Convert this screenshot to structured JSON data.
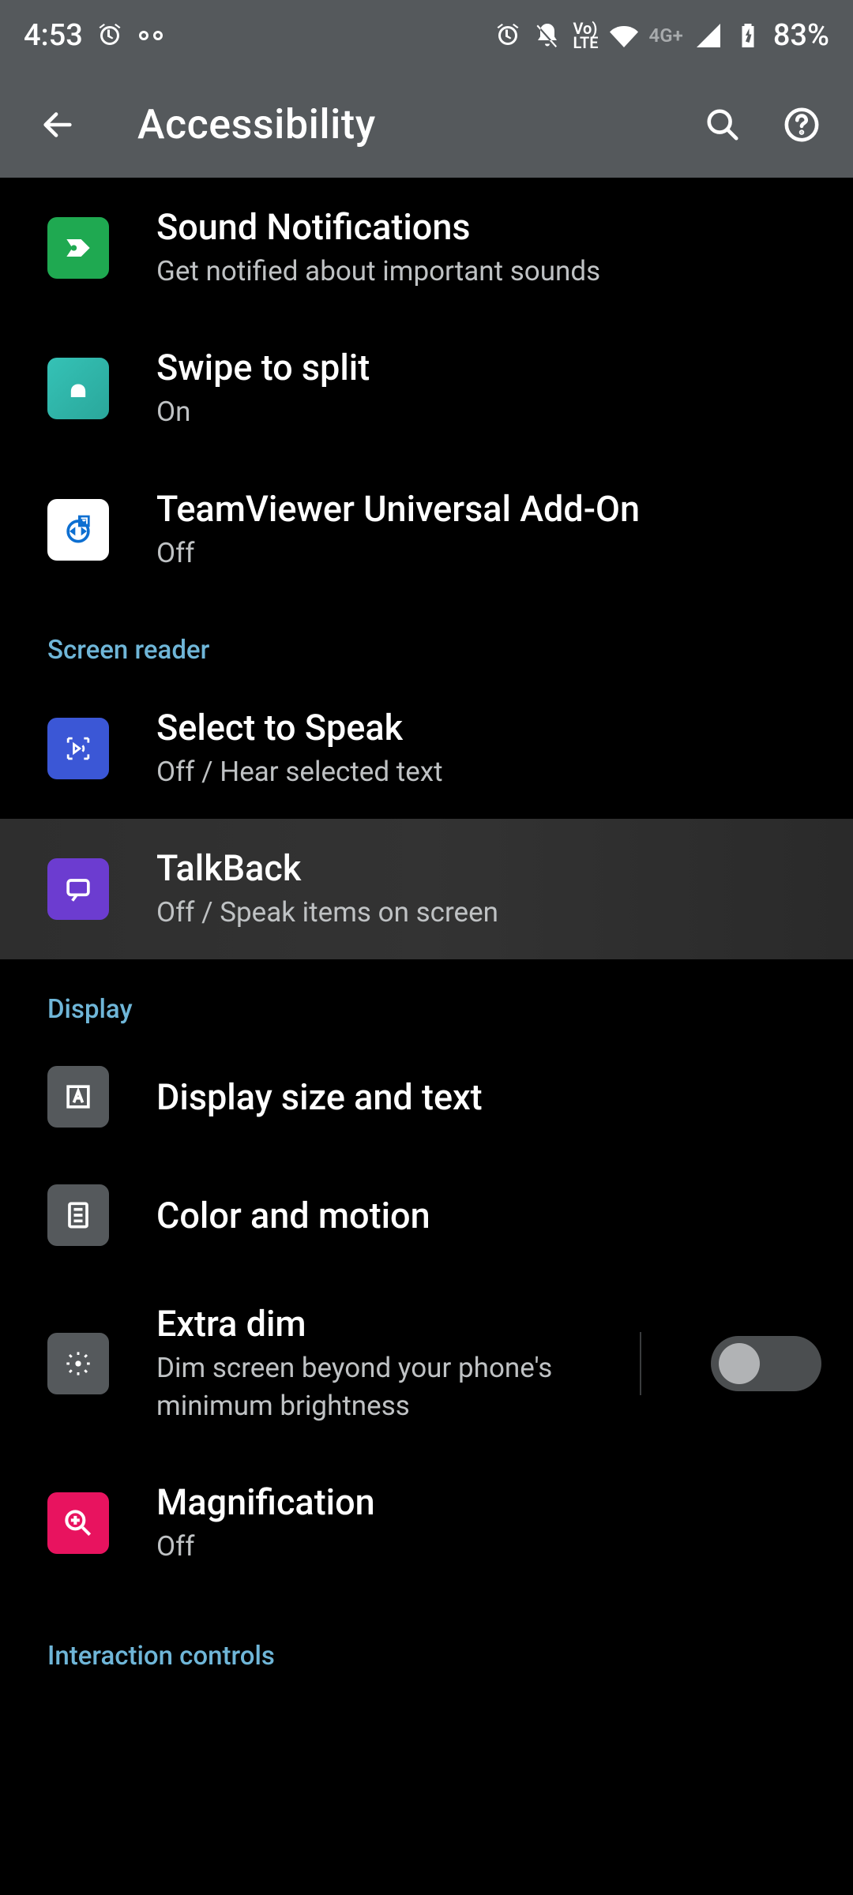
{
  "statusbar": {
    "time": "4:53",
    "lte_top": "Vo)",
    "lte_bottom": "LTE",
    "network": "4G+",
    "battery": "83%"
  },
  "appbar": {
    "title": "Accessibility"
  },
  "items": {
    "sound_notifications": {
      "label": "Sound Notifications",
      "sub": "Get notified about important sounds"
    },
    "swipe_split": {
      "label": "Swipe to split",
      "sub": "On"
    },
    "teamviewer": {
      "label": "TeamViewer Universal Add-On",
      "sub": "Off"
    },
    "select_speak": {
      "label": "Select to Speak",
      "sub": "Off / Hear selected text"
    },
    "talkback": {
      "label": "TalkBack",
      "sub": "Off / Speak items on screen"
    },
    "display_size": {
      "label": "Display size and text"
    },
    "color_motion": {
      "label": "Color and motion"
    },
    "extra_dim": {
      "label": "Extra dim",
      "sub": "Dim screen beyond your phone's minimum brightness",
      "state": "off"
    },
    "magnification": {
      "label": "Magnification",
      "sub": "Off"
    }
  },
  "sections": {
    "screen_reader": "Screen reader",
    "display": "Display",
    "interaction": "Interaction controls"
  }
}
